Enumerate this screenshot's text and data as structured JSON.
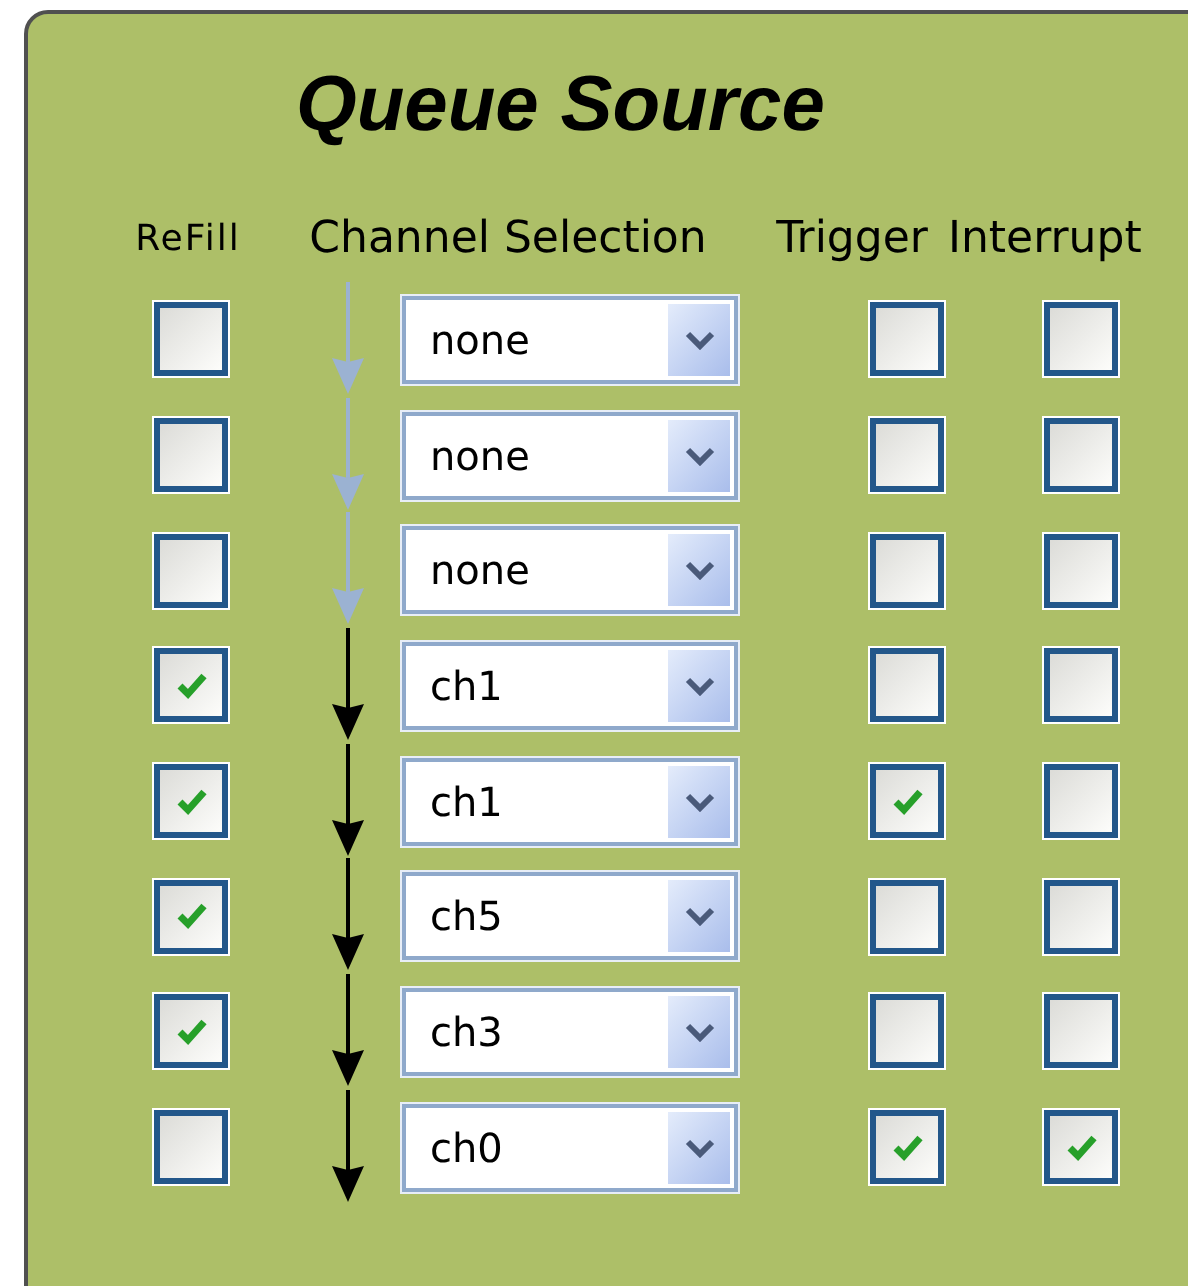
{
  "title": "Queue Source",
  "columns": [
    "ReFill",
    "Channel Selection",
    "Trigger",
    "Interrupt"
  ],
  "rows": [
    {
      "refill": false,
      "channel": "none",
      "linked": false,
      "trigger": false,
      "interrupt": false
    },
    {
      "refill": false,
      "channel": "none",
      "linked": false,
      "trigger": false,
      "interrupt": false
    },
    {
      "refill": false,
      "channel": "none",
      "linked": false,
      "trigger": false,
      "interrupt": false
    },
    {
      "refill": true,
      "channel": "ch1",
      "linked": true,
      "trigger": false,
      "interrupt": false
    },
    {
      "refill": true,
      "channel": "ch1",
      "linked": true,
      "trigger": true,
      "interrupt": false
    },
    {
      "refill": true,
      "channel": "ch5",
      "linked": true,
      "trigger": false,
      "interrupt": false
    },
    {
      "refill": true,
      "channel": "ch3",
      "linked": true,
      "trigger": false,
      "interrupt": false
    },
    {
      "refill": false,
      "channel": "ch0",
      "linked": true,
      "trigger": true,
      "interrupt": true
    }
  ]
}
